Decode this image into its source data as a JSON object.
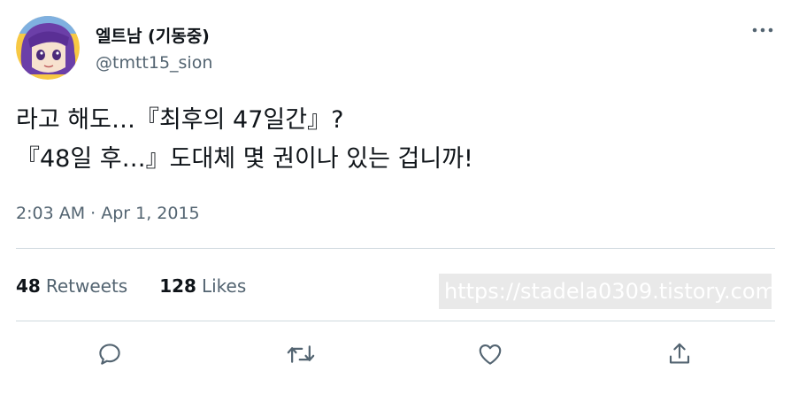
{
  "author": {
    "display_name": "엘트남 (기동중)",
    "handle": "@tmtt15_sion"
  },
  "tweet": {
    "lines": [
      "라고 해도…『최후의 47일간』?",
      "『48일 후…』도대체 몇 권이나 있는 겁니까!"
    ],
    "timestamp": "2:03 AM · Apr 1, 2015"
  },
  "stats": {
    "retweets_count": "48",
    "retweets_label": "Retweets",
    "likes_count": "128",
    "likes_label": "Likes"
  },
  "watermark": {
    "text": "https://stadela0309.tistory.com"
  },
  "icons": {
    "more": "more-horizontal-icon",
    "reply": "reply-icon",
    "retweet": "retweet-icon",
    "like": "heart-icon",
    "share": "share-icon"
  },
  "colors": {
    "text_primary": "#0f1419",
    "text_secondary": "#536471",
    "divider": "#cfd9de",
    "avatar_hair": "#6b3fa8",
    "avatar_border": "#f5c234"
  }
}
